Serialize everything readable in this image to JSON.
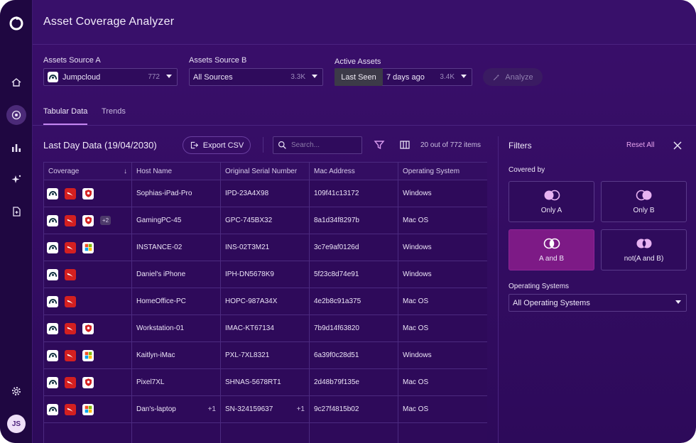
{
  "app": {
    "title": "Asset Coverage Analyzer",
    "colors": {
      "accent": "#c686f2",
      "active_option": "#7d1a86",
      "background": "#38106a",
      "sidebar": "#1f0741"
    }
  },
  "sidebar": {
    "items": [
      {
        "icon": "home-icon"
      },
      {
        "icon": "coverage-icon",
        "active": true
      },
      {
        "icon": "bar-chart-icon"
      },
      {
        "icon": "sparkle-icon"
      },
      {
        "icon": "document-icon"
      }
    ],
    "settings_icon": "gear-icon",
    "avatar_initials": "JS"
  },
  "controls": {
    "source_a": {
      "label": "Assets Source A",
      "value": "Jumpcloud",
      "count": "772"
    },
    "source_b": {
      "label": "Assets Source B",
      "value": "All Sources",
      "count": "3.3K"
    },
    "active_assets": {
      "label": "Active Assets",
      "mode": "Last Seen",
      "value": "7 days ago",
      "count": "3.4K"
    },
    "analyze_label": "Analyze"
  },
  "tabs": [
    {
      "label": "Tabular Data",
      "active": true
    },
    {
      "label": "Trends",
      "active": false
    }
  ],
  "table_section": {
    "title": "Last Day Data (19/04/2030)",
    "export_label": "Export CSV",
    "search_placeholder": "Search...",
    "items_count": "20 out of 772 items",
    "columns": [
      "Coverage",
      "Host Name",
      "Original Serial Number",
      "Mac Address",
      "Operating System"
    ],
    "rows": [
      {
        "coverage": [
          "jumpcloud",
          "crowdstrike",
          "shield"
        ],
        "extra": "",
        "host": "Sophias-iPad-Pro",
        "host_plus": "",
        "serial": "IPD-23A4X98",
        "serial_plus": "",
        "mac": "109f41c13172",
        "os": "Windows"
      },
      {
        "coverage": [
          "jumpcloud",
          "crowdstrike",
          "shield"
        ],
        "extra": "+2",
        "host": "GamingPC-45",
        "host_plus": "",
        "serial": "GPC-745BX32",
        "serial_plus": "",
        "mac": "8a1d34f8297b",
        "os": "Mac OS"
      },
      {
        "coverage": [
          "jumpcloud",
          "crowdstrike",
          "microsoft"
        ],
        "extra": "",
        "host": "INSTANCE-02",
        "host_plus": "",
        "serial": "INS-02T3M21",
        "serial_plus": "",
        "mac": "3c7e9af0126d",
        "os": "Windows"
      },
      {
        "coverage": [
          "jumpcloud",
          "crowdstrike"
        ],
        "extra": "",
        "host": "Daniel's iPhone",
        "host_plus": "",
        "serial": "IPH-DN5678K9",
        "serial_plus": "",
        "mac": "5f23c8d74e91",
        "os": "Windows"
      },
      {
        "coverage": [
          "jumpcloud",
          "crowdstrike"
        ],
        "extra": "",
        "host": "HomeOffice-PC",
        "host_plus": "",
        "serial": "HOPC-987A34X",
        "serial_plus": "",
        "mac": "4e2b8c91a375",
        "os": "Mac OS"
      },
      {
        "coverage": [
          "jumpcloud",
          "crowdstrike",
          "shield"
        ],
        "extra": "",
        "host": "Workstation-01",
        "host_plus": "",
        "serial": "IMAC-KT67134",
        "serial_plus": "",
        "mac": "7b9d14f63820",
        "os": "Mac OS"
      },
      {
        "coverage": [
          "jumpcloud",
          "crowdstrike",
          "microsoft"
        ],
        "extra": "",
        "host": "Kaitlyn-iMac",
        "host_plus": "",
        "serial": "PXL-7XL8321",
        "serial_plus": "",
        "mac": "6a39f0c28d51",
        "os": "Windows"
      },
      {
        "coverage": [
          "jumpcloud",
          "crowdstrike",
          "shield"
        ],
        "extra": "",
        "host": "Pixel7XL",
        "host_plus": "",
        "serial": "SHNAS-5678RT1",
        "serial_plus": "",
        "mac": "2d48b79f135e",
        "os": "Mac OS"
      },
      {
        "coverage": [
          "jumpcloud",
          "crowdstrike",
          "microsoft"
        ],
        "extra": "",
        "host": "Dan's-laptop",
        "host_plus": "+1",
        "serial": "SN-324159637",
        "serial_plus": "+1",
        "mac": "9c27f4815b02",
        "os": "Mac OS"
      }
    ]
  },
  "filters": {
    "title": "Filters",
    "reset_label": "Reset All",
    "covered_by_label": "Covered by",
    "options": [
      {
        "label": "Only A",
        "active": false
      },
      {
        "label": "Only B",
        "active": false
      },
      {
        "label": "A and B",
        "active": true
      },
      {
        "label": "not(A and B)",
        "active": false
      }
    ],
    "os_label": "Operating Systems",
    "os_value": "All Operating Systems"
  }
}
